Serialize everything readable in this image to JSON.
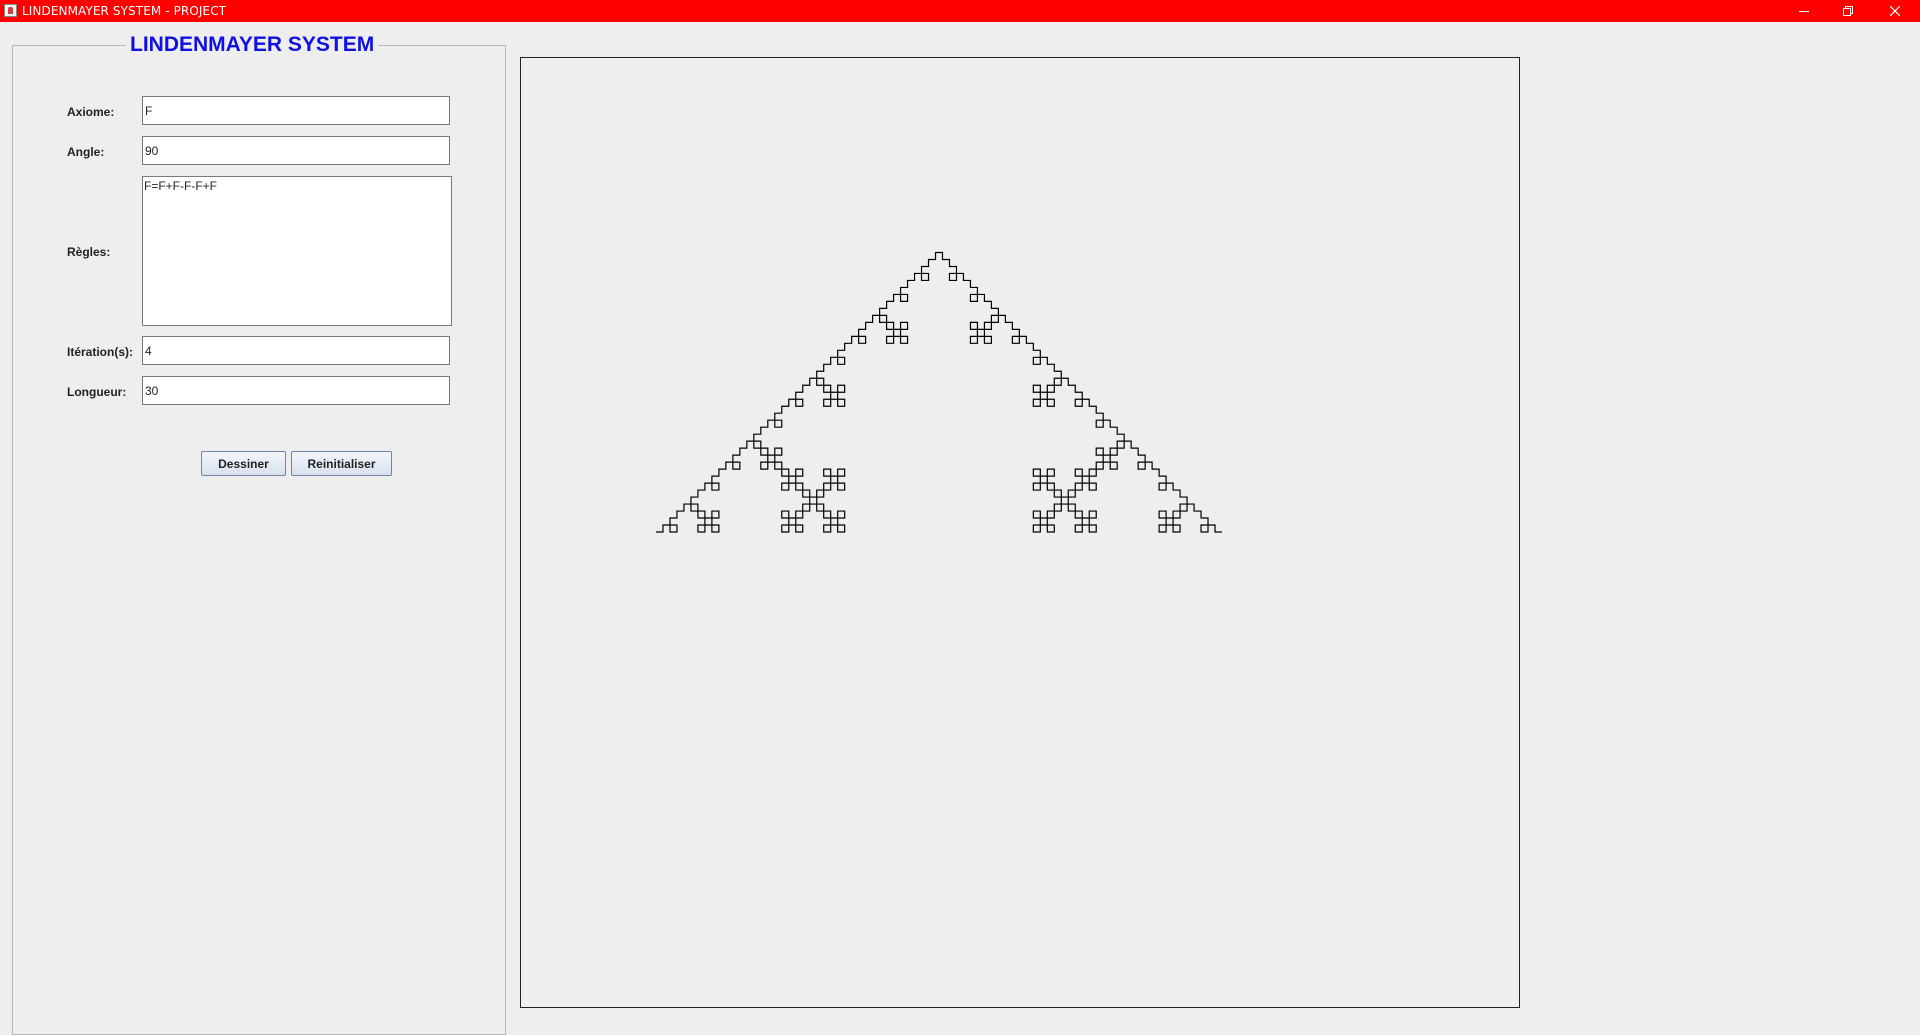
{
  "window": {
    "title": "LINDENMAYER SYSTEM - PROJECT",
    "title_bar_color": "#ff0000",
    "icons": [
      "java-app-icon",
      "minimize-icon",
      "restore-icon",
      "close-icon"
    ]
  },
  "panel": {
    "title": "LINDENMAYER SYSTEM",
    "title_color": "#1010e0",
    "fields": {
      "axiom": {
        "label": "Axiome:",
        "value": "F"
      },
      "angle": {
        "label": "Angle:",
        "value": "90"
      },
      "rules": {
        "label": "Règles:",
        "value": "F=F+F-F-F+F"
      },
      "iterations": {
        "label": "Itération(s):",
        "value": "4"
      },
      "length": {
        "label": "Longueur:",
        "value": "30"
      }
    },
    "buttons": {
      "draw": "Dessiner",
      "reset": "Reinitialiser"
    }
  },
  "canvas": {
    "line_color": "#000000",
    "description_source": "L-system turtle rendering of the rule set above"
  }
}
